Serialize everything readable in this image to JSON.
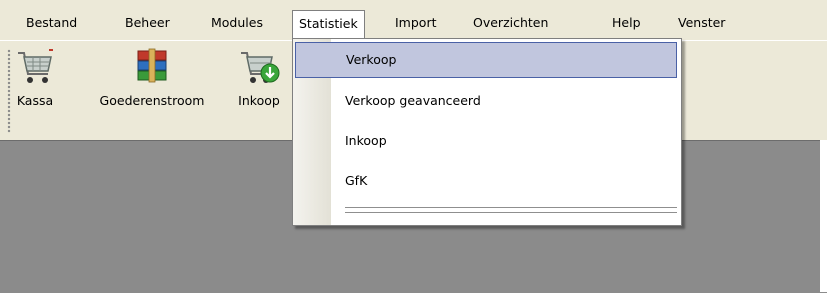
{
  "menubar": {
    "items": [
      "Bestand",
      "Beheer",
      "Modules",
      "Statistiek",
      "Import",
      "Overzichten",
      "Help",
      "Venster"
    ]
  },
  "toolbar": {
    "buttons": [
      {
        "label": "Kassa",
        "icon": "shopping-cart-icon"
      },
      {
        "label": "Goederenstroom",
        "icon": "stacked-boxes-icon"
      },
      {
        "label": "Inkoop",
        "icon": "cart-download-icon"
      }
    ]
  },
  "dropdown": {
    "parent": "Statistiek",
    "items": [
      "Verkoop",
      "Verkoop geavanceerd",
      "Inkoop",
      "GfK"
    ],
    "highlighted": "Verkoop"
  }
}
